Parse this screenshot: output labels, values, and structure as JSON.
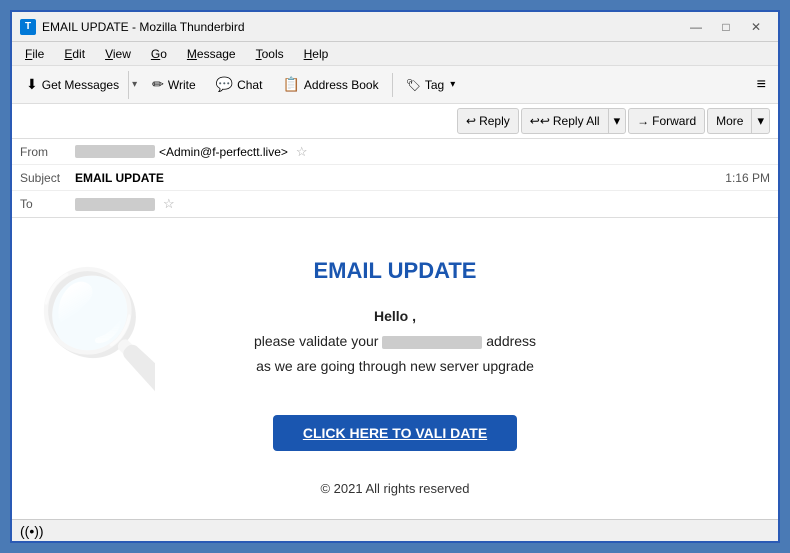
{
  "window": {
    "title": "EMAIL UPDATE - Mozilla Thunderbird",
    "icon": "T"
  },
  "titlebar": {
    "minimize": "—",
    "maximize": "□",
    "close": "✕"
  },
  "menubar": {
    "items": [
      {
        "label": "File",
        "underline": "F"
      },
      {
        "label": "Edit",
        "underline": "E"
      },
      {
        "label": "View",
        "underline": "V"
      },
      {
        "label": "Go",
        "underline": "G"
      },
      {
        "label": "Message",
        "underline": "M"
      },
      {
        "label": "Tools",
        "underline": "T"
      },
      {
        "label": "Help",
        "underline": "H"
      }
    ]
  },
  "toolbar": {
    "get_messages": "Get Messages",
    "write": "Write",
    "chat": "Chat",
    "address_book": "Address Book",
    "tag": "Tag",
    "hamburger": "≡"
  },
  "email": {
    "from_label": "From",
    "from_value": "<Admin@f-perfectt.live>",
    "subject_label": "Subject",
    "subject_value": "EMAIL UPDATE",
    "to_label": "To",
    "timestamp": "1:16 PM",
    "reply_label": "Reply",
    "reply_all_label": "Reply All",
    "forward_label": "Forward",
    "more_label": "More"
  },
  "email_body": {
    "title": "EMAIL UPDATE",
    "greeting": "Hello ,",
    "line1_before": "please validate your",
    "line1_after": "address",
    "line2": "as we are going through new server upgrade",
    "button": "CLICK HERE TO VALI DATE",
    "copyright": "© 2021 All rights reserved"
  },
  "statusbar": {
    "icon": "((•))"
  }
}
